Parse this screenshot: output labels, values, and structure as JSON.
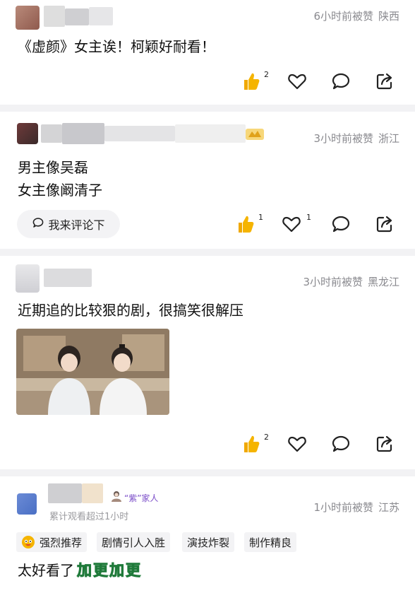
{
  "comments": [
    {
      "meta": {
        "time": "6小时前被赞",
        "location": "陕西"
      },
      "text_lines": [
        "《虚颜》女主诶！柯颖好耐看！"
      ],
      "thumb_count": "2",
      "heart_count": ""
    },
    {
      "meta": {
        "time": "3小时前被赞",
        "location": "浙江"
      },
      "text_lines": [
        "男主像吴磊",
        "女主像阚清子"
      ],
      "reply_pill": "我来评论下",
      "thumb_count": "1",
      "heart_count": "1"
    },
    {
      "meta": {
        "time": "3小时前被赞",
        "location": "黑龙江"
      },
      "text_lines": [
        "近期追的比较狠的剧，很搞笑很解压"
      ],
      "thumb_count": "2",
      "heart_count": ""
    },
    {
      "meta": {
        "time": "1小时前被赞",
        "location": "江苏"
      },
      "badge": "“紫”家人",
      "watch_info": "累计观看超过1小时",
      "tags": [
        "强烈推荐",
        "剧情引人入胜",
        "演技炸裂",
        "制作精良"
      ],
      "text": "太好看了",
      "sticker": "加更加更"
    }
  ],
  "colors": {
    "accent_thumb": "#f5b400",
    "meta_gray": "#8a8a8f",
    "badge_purple": "#7a4cc8"
  },
  "icons": [
    "thumbs-up-icon",
    "heart-icon",
    "comment-bubble-icon",
    "share-icon",
    "level-badge-icon"
  ]
}
